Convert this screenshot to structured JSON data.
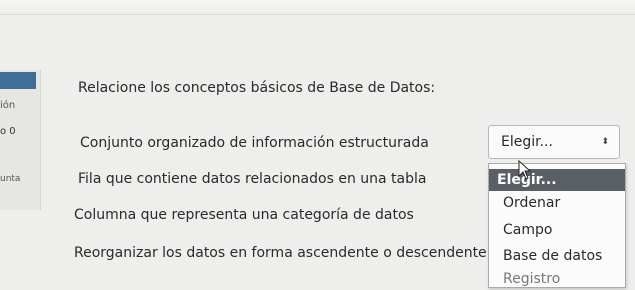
{
  "sidebar": {
    "label_1": "ión",
    "label_2": "o 0",
    "label_3": "unta"
  },
  "question": {
    "title": "Relacione los conceptos básicos de Base de Datos:"
  },
  "rows": [
    {
      "text": "Conjunto organizado de información estructurada"
    },
    {
      "text": "Fila que contiene datos relacionados en una tabla"
    },
    {
      "text": "Columna que representa una categoría de datos"
    },
    {
      "text": "Reorganizar los datos en forma ascendente o descendente"
    }
  ],
  "select": {
    "value": "Elegir...",
    "arrows": "⬍"
  },
  "dropdown": {
    "options": [
      "Elegir...",
      "Ordenar",
      "Campo",
      "Base de datos",
      "Registro"
    ]
  },
  "colors": {
    "accent": "#3f6f99",
    "selected_option_bg": "#5a5f66"
  }
}
